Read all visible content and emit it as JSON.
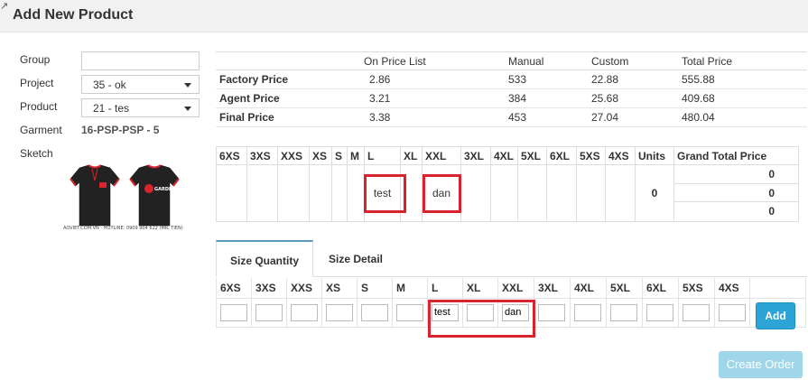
{
  "header": {
    "title": "Add New Product"
  },
  "form": {
    "group_label": "Group",
    "group_value": "",
    "project_label": "Project",
    "project_value": "35 - ok",
    "product_label": "Product",
    "product_value": "21 - tes",
    "garment_label": "Garment",
    "garment_value": "16-PSP-PSP - 5",
    "sketch_label": "Sketch",
    "sketch_caption": "AOVIET.COM.VN - HOTLINE: 0909 904 622 (MR. TIEN)",
    "sketch_brand": "GARDEN"
  },
  "price_table": {
    "headers": [
      "",
      "On Price List",
      "Manual",
      "Custom",
      "Total Price"
    ],
    "rows": [
      {
        "label": "Factory Price",
        "values": [
          "2.86",
          "533",
          "22.88",
          "555.88"
        ]
      },
      {
        "label": "Agent Price",
        "values": [
          "3.21",
          "384",
          "25.68",
          "409.68"
        ]
      },
      {
        "label": "Final Price",
        "values": [
          "3.38",
          "453",
          "27.04",
          "480.04"
        ]
      }
    ]
  },
  "size_table": {
    "sizes": [
      "6XS",
      "3XS",
      "XXS",
      "XS",
      "S",
      "M",
      "L",
      "XL",
      "XXL",
      "3XL",
      "4XL",
      "5XL",
      "6XL",
      "5XS",
      "4XS"
    ],
    "units_label": "Units",
    "grand_total_label": "Grand Total Price",
    "values": [
      "",
      "",
      "",
      "",
      "",
      "",
      "test",
      "",
      "dan",
      "",
      "",
      "",
      "",
      "",
      ""
    ],
    "units_value": "0",
    "grand_totals": [
      "0",
      "0",
      "0"
    ]
  },
  "tabs": [
    {
      "label": "Size Quantity",
      "active": true
    },
    {
      "label": "Size Detail",
      "active": false
    }
  ],
  "qty_table": {
    "sizes": [
      "6XS",
      "3XS",
      "XXS",
      "XS",
      "S",
      "M",
      "L",
      "XL",
      "XXL",
      "3XL",
      "4XL",
      "5XL",
      "6XL",
      "5XS",
      "4XS"
    ],
    "values": [
      "",
      "",
      "",
      "",
      "",
      "",
      "test",
      "",
      "dan",
      "",
      "",
      "",
      "",
      "",
      ""
    ],
    "add_label": "Add"
  },
  "actions": {
    "create_order_label": "Create Order"
  },
  "colors": {
    "accent": "#2ea4d6",
    "highlight": "#d9232d",
    "disabled_button": "#9fd6ea"
  }
}
